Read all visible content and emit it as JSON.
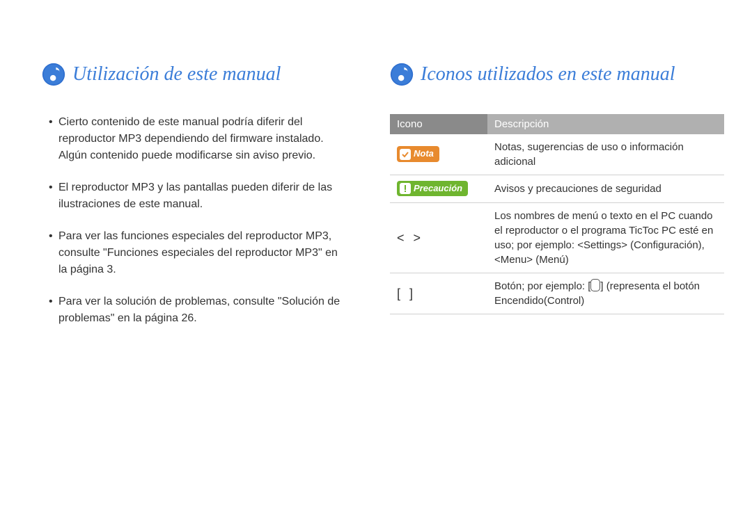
{
  "left": {
    "title": "Utilización de este manual",
    "bullets": [
      "Cierto contenido de este manual podría diferir del reproductor MP3 dependiendo del firmware instalado. Algún contenido puede modificarse sin aviso previo.",
      "El reproductor MP3 y las pantallas pueden diferir de las ilustraciones de este manual.",
      "Para ver las funciones especiales del reproductor MP3, consulte \"Funciones especiales del reproductor MP3\" en la página 3.",
      "Para ver la solución de problemas, consulte \"Solución de problemas\" en la página 26."
    ]
  },
  "right": {
    "title": "Iconos utilizados en este manual",
    "table": {
      "header_icon": "Icono",
      "header_desc": "Descripción",
      "rows": [
        {
          "icon_type": "badge_nota",
          "icon_label": "Nota",
          "desc": "Notas, sugerencias de uso o información adicional"
        },
        {
          "icon_type": "badge_prec",
          "icon_label": "Precaución",
          "desc": "Avisos y precauciones de seguridad"
        },
        {
          "icon_type": "angle",
          "icon_label": "<  >",
          "desc": "Los nombres de menú o texto en el PC cuando el reproductor o el programa TicToc PC esté en uso; por ejemplo: <Settings> (Configuración), <Menu> (Menú)"
        },
        {
          "icon_type": "bracket",
          "icon_label": "[    ]",
          "desc_pre": "Botón; por ejemplo: [",
          "desc_post": "] (representa el botón Encendido(Control)"
        }
      ]
    }
  }
}
